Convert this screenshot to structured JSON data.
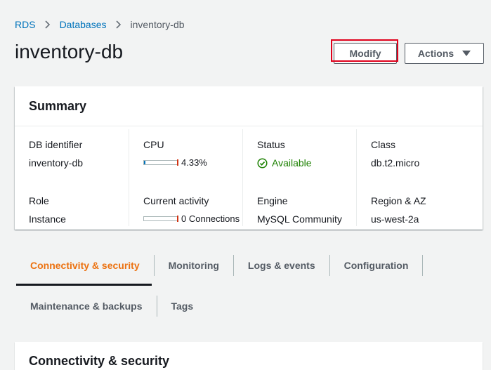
{
  "breadcrumb": {
    "items": [
      "RDS",
      "Databases"
    ],
    "current": "inventory-db"
  },
  "page": {
    "title": "inventory-db"
  },
  "buttons": {
    "modify": "Modify",
    "actions": "Actions"
  },
  "summary": {
    "title": "Summary",
    "fields": {
      "db_identifier": {
        "label": "DB identifier",
        "value": "inventory-db"
      },
      "cpu": {
        "label": "CPU",
        "value": "4.33%",
        "percent": 4.33
      },
      "status": {
        "label": "Status",
        "value": "Available"
      },
      "class": {
        "label": "Class",
        "value": "db.t2.micro"
      },
      "role": {
        "label": "Role",
        "value": "Instance"
      },
      "current_activity": {
        "label": "Current activity",
        "value": "0 Connections",
        "count": 0
      },
      "engine": {
        "label": "Engine",
        "value": "MySQL Community"
      },
      "region": {
        "label": "Region & AZ",
        "value": "us-west-2a"
      }
    }
  },
  "tabs": [
    {
      "label": "Connectivity & security",
      "active": true
    },
    {
      "label": "Monitoring"
    },
    {
      "label": "Logs & events"
    },
    {
      "label": "Configuration"
    },
    {
      "label": "Maintenance & backups"
    },
    {
      "label": "Tags"
    }
  ],
  "section": {
    "title": "Connectivity & security"
  },
  "colors": {
    "link": "#0073bb",
    "accent": "#ec7211",
    "success": "#1d8102",
    "highlight": "#e0001b"
  },
  "icons": {
    "separator": "chevron-right-icon",
    "actions": "caret-down-icon",
    "status": "check-circle-icon"
  }
}
